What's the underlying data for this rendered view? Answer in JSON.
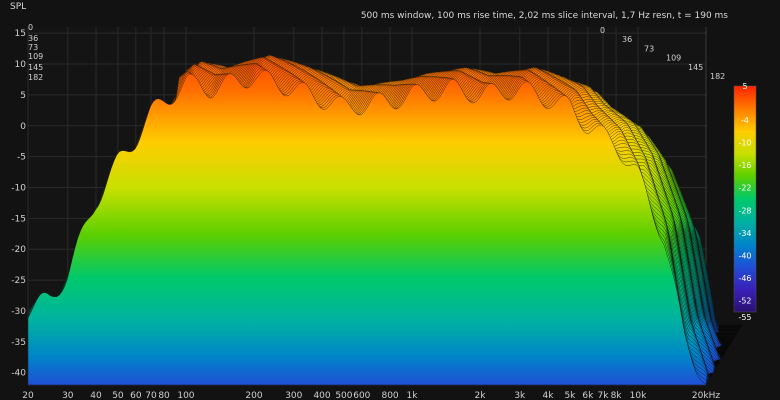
{
  "window": {
    "info_text": "500 ms window, 100 ms rise time, 2,02 ms slice interval, 1,7 Hz resn, t = 190 ms"
  },
  "chart_data": {
    "type": "area",
    "subtype": "waterfall",
    "title": "",
    "xlabel": "",
    "ylabel": "SPL",
    "x_scale": "log",
    "xlim": [
      20,
      20000
    ],
    "ylim": [
      -42,
      16
    ],
    "x_ticks": [
      "20",
      "30",
      "40",
      "50",
      "60",
      "70",
      "80",
      "100",
      "200",
      "300",
      "400",
      "500",
      "600",
      "800",
      "1k",
      "2k",
      "3k",
      "4k",
      "5k",
      "6k",
      "7k",
      "8k",
      "10k",
      "20kHz"
    ],
    "x_tick_values": [
      20,
      30,
      40,
      50,
      60,
      70,
      80,
      100,
      200,
      300,
      400,
      500,
      600,
      800,
      1000,
      2000,
      3000,
      4000,
      5000,
      6000,
      7000,
      8000,
      10000,
      20000
    ],
    "y_ticks": [
      15,
      10,
      5,
      0,
      -5,
      -10,
      -15,
      -20,
      -25,
      -30,
      -35,
      -40
    ],
    "time_axis_ticks": [
      "0",
      "36",
      "73",
      "109",
      "145",
      "182"
    ],
    "time_axis_values_ms": [
      0,
      36,
      73,
      109,
      145,
      182
    ],
    "colorbar": {
      "ticks": [
        5,
        -4,
        -10,
        -16,
        -22,
        -28,
        -34,
        -40,
        -46,
        -52,
        -55
      ],
      "colors": [
        "#ff2200",
        "#ff7a00",
        "#ffcc00",
        "#c8e000",
        "#5ccf00",
        "#00c96b",
        "#00b2a0",
        "#0086c8",
        "#1f4fd6",
        "#3a1fb8",
        "#2a1070"
      ]
    },
    "slice_count": 95,
    "series": [
      {
        "time_ms": 0,
        "x": [
          20,
          25,
          30,
          40,
          50,
          60,
          70,
          80,
          100,
          130,
          200,
          300,
          500,
          800,
          1000,
          1500,
          2000,
          3000,
          5000,
          6000,
          8000,
          10000,
          13000,
          16000,
          20000
        ],
        "values": [
          -30,
          -28,
          -24,
          -12,
          -6,
          -2,
          2,
          4,
          7,
          6,
          8,
          6,
          3,
          4,
          5,
          6,
          5,
          6,
          3,
          0,
          -3,
          -8,
          -18,
          -34,
          -42
        ]
      },
      {
        "time_ms": 182,
        "x": [
          20,
          25,
          30,
          40,
          50,
          60,
          70,
          80,
          100,
          130,
          200,
          300,
          500,
          800,
          1000,
          1500,
          2000,
          3000,
          5000,
          6000,
          8000,
          10000,
          13000,
          16000,
          20000
        ],
        "values": [
          -40,
          -40,
          -40,
          -40,
          -40,
          -40,
          -40,
          -40,
          -40,
          -40,
          -40,
          -40,
          -40,
          -40,
          -40,
          -40,
          -40,
          -40,
          -40,
          -40,
          -40,
          -40,
          -40,
          -40,
          -40
        ]
      }
    ]
  }
}
